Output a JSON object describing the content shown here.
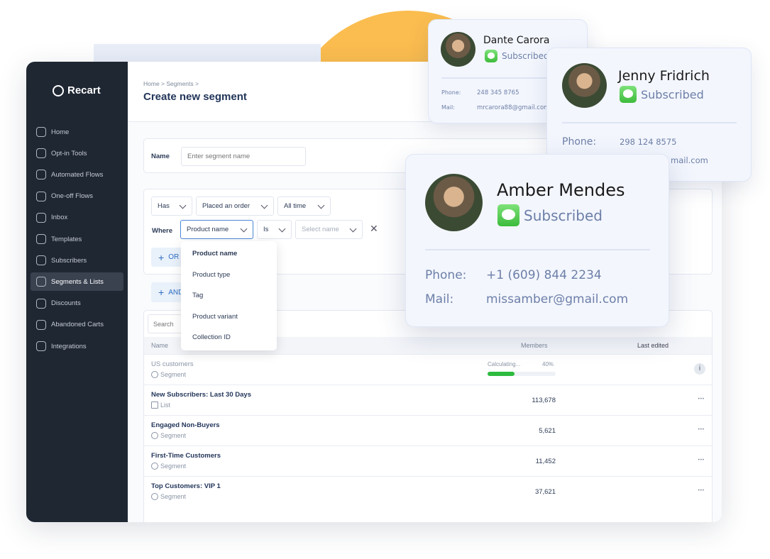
{
  "brand": "Recart",
  "sidebar": {
    "items": [
      {
        "label": "Home",
        "icon": "home-icon"
      },
      {
        "label": "Opt-in Tools",
        "icon": "rocket-icon"
      },
      {
        "label": "Automated Flows",
        "icon": "chat-gear-icon"
      },
      {
        "label": "One-off Flows",
        "icon": "chat-arrow-icon"
      },
      {
        "label": "Inbox",
        "icon": "inbox-icon"
      },
      {
        "label": "Templates",
        "icon": "template-icon"
      },
      {
        "label": "Subscribers",
        "icon": "users-icon"
      },
      {
        "label": "Segments & Lists",
        "icon": "pie-icon",
        "active": true
      },
      {
        "label": "Discounts",
        "icon": "percent-icon"
      },
      {
        "label": "Abandoned Carts",
        "icon": "cart-icon"
      },
      {
        "label": "Integrations",
        "icon": "integrations-icon"
      }
    ]
  },
  "header": {
    "breadcrumb": [
      "Home",
      "Segments"
    ],
    "title": "Create new segment"
  },
  "name_field": {
    "label": "Name",
    "placeholder": "Enter segment name"
  },
  "filter": {
    "has": "Has",
    "event": "Placed an order",
    "time": "All time",
    "where_label": "Where",
    "property": "Product name",
    "operator": "Is",
    "value_placeholder": "Select name",
    "or_label": "OR",
    "and_label": "AND"
  },
  "dropdown": {
    "options": [
      "Product name",
      "Product type",
      "Tag",
      "Product variant",
      "Collection ID"
    ]
  },
  "table": {
    "search_placeholder": "Search",
    "columns": [
      "Name",
      "Members",
      "Last edited"
    ],
    "rows": [
      {
        "name": "US customers",
        "type": "Segment",
        "status": "Calculating...",
        "progress": 40,
        "progress_label": "40%"
      },
      {
        "name": "New Subscribers: Last 30 Days",
        "type": "List",
        "members": "113,678"
      },
      {
        "name": "Engaged Non-Buyers",
        "type": "Segment",
        "members": "5,621"
      },
      {
        "name": "First-Time Customers",
        "type": "Segment",
        "members": "11,452"
      },
      {
        "name": "Top Customers: VIP 1",
        "type": "Segment",
        "members": "37,621"
      }
    ]
  },
  "contacts": [
    {
      "name": "Dante Carora",
      "status": "Subscribed",
      "phone_label": "Phone:",
      "phone": "248 345 8765",
      "mail_label": "Mail:",
      "mail": "mrcarora88@gmail.com"
    },
    {
      "name": "Jenny Fridrich",
      "status": "Subscribed",
      "phone_label": "Phone:",
      "phone": "298 124 8575",
      "mail": "mail.com"
    },
    {
      "name": "Amber Mendes",
      "status": "Subscribed",
      "phone_label": "Phone:",
      "phone": "+1 (609) 844 2234",
      "mail_label": "Mail:",
      "mail": "missamber@gmail.com"
    }
  ],
  "colors": {
    "sidebar": "#1f2733",
    "accent": "#2f6fc4",
    "progress": "#2dbb3f",
    "sun": "#fbbd4f"
  }
}
